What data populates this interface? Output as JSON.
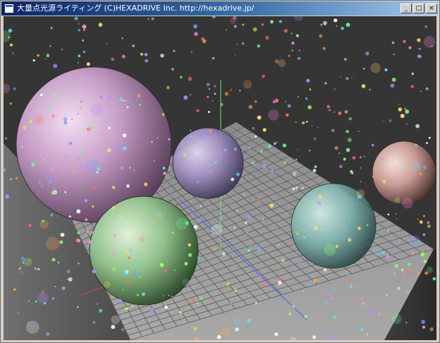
{
  "window": {
    "title": "大量点光源ライティング  (C)HEXADRIVE Inc.  http://hexadrive.jp/",
    "minimize_glyph": "_",
    "maximize_glyph": "□",
    "close_glyph": "×",
    "icon": "app-window-icon"
  },
  "scene": {
    "description_colors": {
      "background": "#3a3a3a",
      "floor": "#9a9a9a",
      "grid_line": "#5a5a5a"
    },
    "spheres": [
      {
        "name": "sphere-pink",
        "color": "#c79ec7"
      },
      {
        "name": "sphere-violet",
        "color": "#a995c9"
      },
      {
        "name": "sphere-green",
        "color": "#8fbf8a"
      },
      {
        "name": "sphere-cyan",
        "color": "#7fb5b0"
      },
      {
        "name": "sphere-salmon",
        "color": "#c79a92"
      }
    ],
    "light_colors": [
      "#ff6b6b",
      "#ffd86b",
      "#6bff8f",
      "#6bd7ff",
      "#b98bff",
      "#ff8be0",
      "#ffffff",
      "#9dff6b",
      "#ffa94d",
      "#74a8ff"
    ]
  }
}
